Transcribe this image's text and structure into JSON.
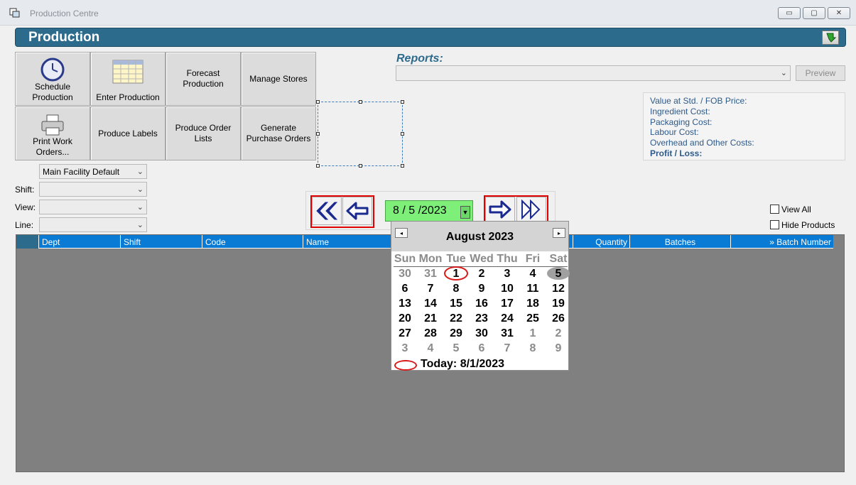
{
  "window": {
    "title": "Production Centre",
    "min": "▭",
    "max": "▢",
    "close": "✕"
  },
  "header": {
    "title": "Production"
  },
  "tiles": [
    {
      "label": "Schedule\nProduction",
      "icon": "clock-icon"
    },
    {
      "label": "Enter Production",
      "icon": "spreadsheet-icon"
    },
    {
      "label": "Forecast\nProduction"
    },
    {
      "label": "Manage Stores"
    },
    {
      "label": "Print Work\nOrders...",
      "icon": "printer-icon"
    },
    {
      "label": "Produce Labels"
    },
    {
      "label": "Produce Order\nLists"
    },
    {
      "label": "Generate\nPurchase Orders"
    }
  ],
  "filters": {
    "facility": "Main Facility Default",
    "shift_label": "Shift:",
    "view_label": "View:",
    "line_label": "Line:"
  },
  "reports": {
    "label": "Reports:",
    "preview": "Preview"
  },
  "costs": {
    "value": "Value at Std. / FOB Price:",
    "ingredient": "Ingredient Cost:",
    "packaging": "Packaging Cost:",
    "labour": "Labour Cost:",
    "overhead": "Overhead and Other Costs:",
    "profit": "Profit / Loss:"
  },
  "date": {
    "value": "8 / 5 /2023"
  },
  "options": {
    "view_all": "View All",
    "hide_products": "Hide Products"
  },
  "grid": {
    "columns": [
      "Dept",
      "Shift",
      "Code",
      "Name",
      "Quantity",
      "Batches",
      "» Batch Number"
    ]
  },
  "calendar": {
    "month": "August 2023",
    "dow": [
      "Sun",
      "Mon",
      "Tue",
      "Wed",
      "Thu",
      "Fri",
      "Sat"
    ],
    "weeks": [
      [
        "30",
        "31",
        "1",
        "2",
        "3",
        "4",
        "5"
      ],
      [
        "6",
        "7",
        "8",
        "9",
        "10",
        "11",
        "12"
      ],
      [
        "13",
        "14",
        "15",
        "16",
        "17",
        "18",
        "19"
      ],
      [
        "20",
        "21",
        "22",
        "23",
        "24",
        "25",
        "26"
      ],
      [
        "27",
        "28",
        "29",
        "30",
        "31",
        "1",
        "2"
      ],
      [
        "3",
        "4",
        "5",
        "6",
        "7",
        "8",
        "9"
      ]
    ],
    "today": "Today: 8/1/2023"
  }
}
